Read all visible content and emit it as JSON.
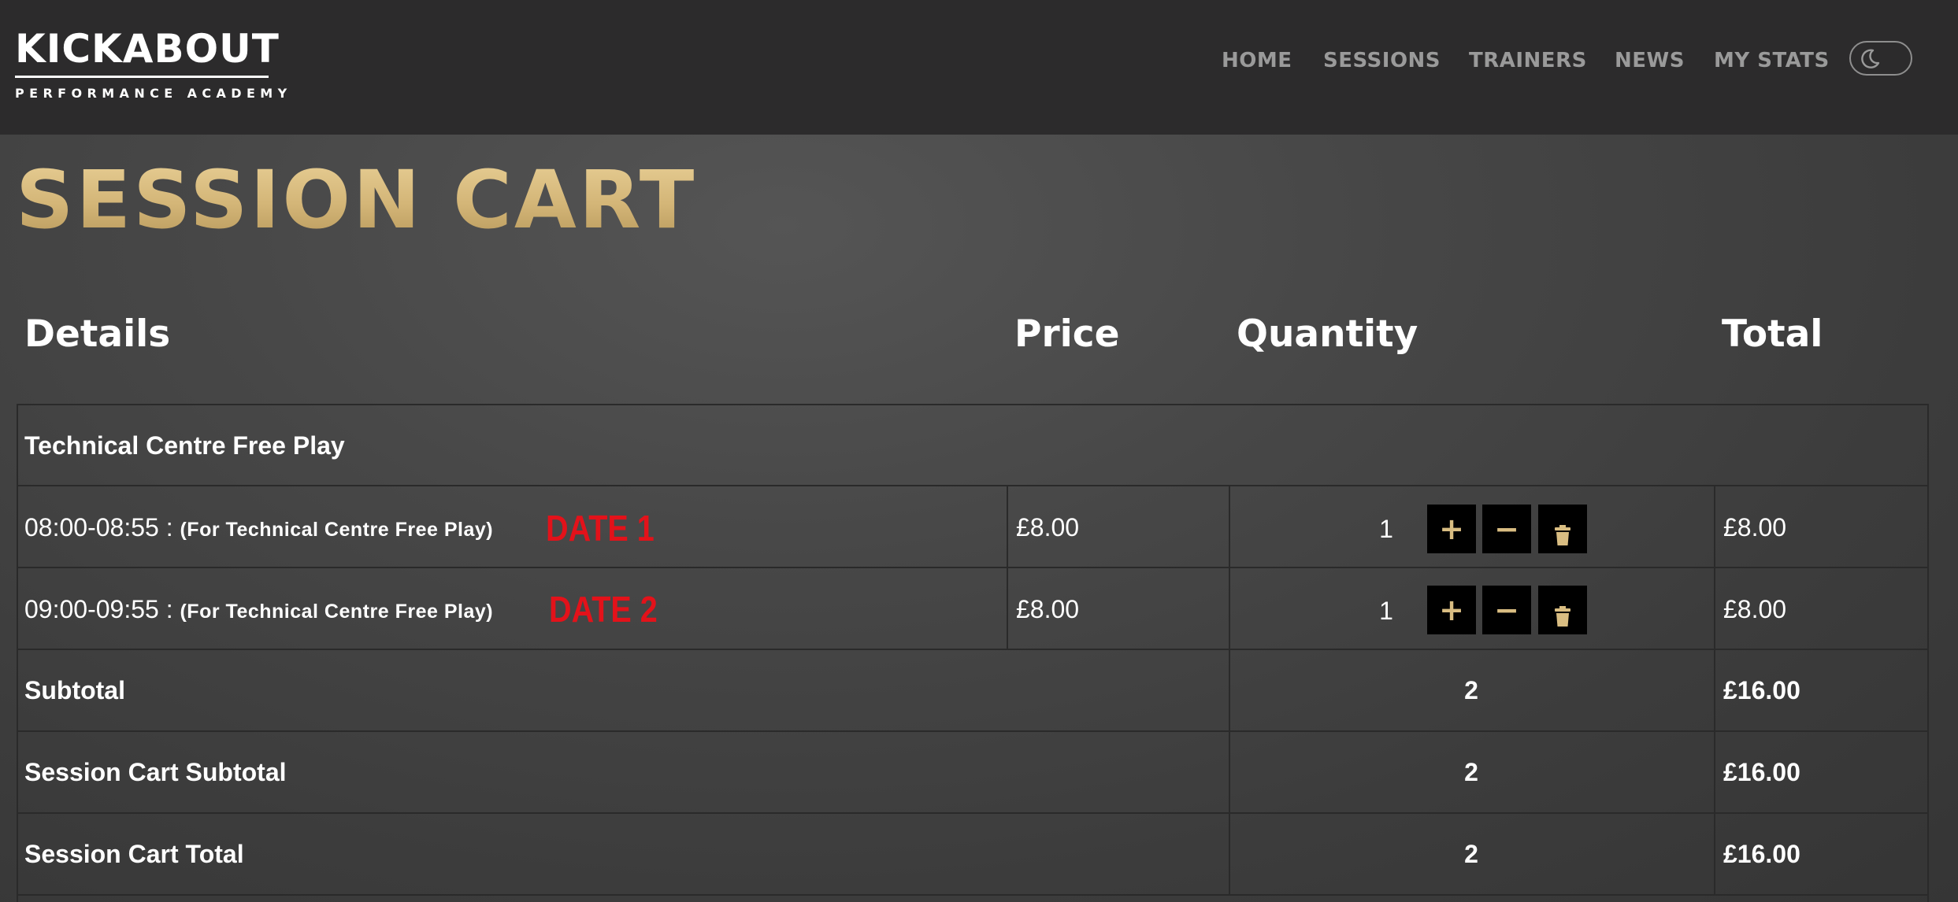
{
  "brand": {
    "name": "KICKABOUT",
    "tagline": "PERFORMANCE ACADEMY"
  },
  "nav": {
    "items": [
      {
        "label": "HOME"
      },
      {
        "label": "SESSIONS"
      },
      {
        "label": "TRAINERS"
      },
      {
        "label": "NEWS"
      },
      {
        "label": "MY STATS"
      }
    ],
    "theme_toggle_icon": "moon-icon"
  },
  "page": {
    "title": "SESSION CART"
  },
  "table": {
    "headers": {
      "details": "Details",
      "price": "Price",
      "quantity": "Quantity",
      "total": "Total"
    },
    "group_title": "Technical Centre Free Play",
    "rows": [
      {
        "time": "08:00-08:55 :",
        "session": "(For Technical Centre Free Play)",
        "annotation": "DATE 1",
        "price": "£8.00",
        "quantity": "1",
        "total": "£8.00"
      },
      {
        "time": "09:00-09:55 :",
        "session": "(For Technical Centre Free Play)",
        "annotation": "DATE 2",
        "price": "£8.00",
        "quantity": "1",
        "total": "£8.00"
      }
    ],
    "buttons": {
      "increase": "+",
      "decrease": "−",
      "increase_icon": "plus-icon",
      "decrease_icon": "minus-icon",
      "delete_icon": "trash-icon"
    },
    "summary": [
      {
        "label": "Subtotal",
        "quantity": "2",
        "total": "£16.00"
      },
      {
        "label": "Session Cart Subtotal",
        "quantity": "2",
        "total": "£16.00"
      },
      {
        "label": "Session Cart Total",
        "quantity": "2",
        "total": "£16.00"
      }
    ]
  },
  "colors": {
    "header_bg": "#2c2b2c",
    "gold_accent": "#d9bd82",
    "annotation_red": "#e3121a",
    "button_bg": "#000000"
  }
}
